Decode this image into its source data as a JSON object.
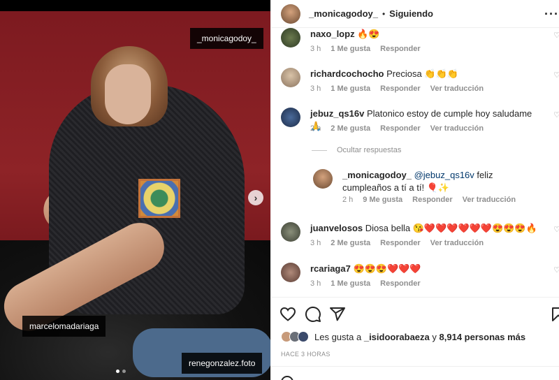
{
  "photo": {
    "tags": [
      "_monicagodoy_",
      "marcelomadariaga",
      "renegonzalez.foto"
    ]
  },
  "header": {
    "username": "_monicagodoy_",
    "separator": "•",
    "follow_status": "Siguiendo",
    "more": "···"
  },
  "comments": [
    {
      "user": "naxo_lopz",
      "text": "🔥😍",
      "time": "3 h",
      "likes": "1 Me gusta",
      "reply": "Responder",
      "translate": ""
    },
    {
      "user": "richardcochocho",
      "text": "Preciosa 👏👏👏",
      "time": "3 h",
      "likes": "1 Me gusta",
      "reply": "Responder",
      "translate": "Ver traducción"
    },
    {
      "user": "jebuz_qs16v",
      "text": "Platonico estoy de cumple hoy saludame 🙏",
      "time": "2 h",
      "likes": "2 Me gusta",
      "reply": "Responder",
      "translate": "Ver traducción"
    },
    {
      "user": "juanvelosos",
      "text": "Diosa bella 😘❤️❤️❤️❤️❤️❤️😍😍😍🔥",
      "time": "3 h",
      "likes": "2 Me gusta",
      "reply": "Responder",
      "translate": "Ver traducción"
    },
    {
      "user": "rcariaga7",
      "text": "😍😍😍❤️❤️❤️",
      "time": "3 h",
      "likes": "1 Me gusta",
      "reply": "Responder",
      "translate": ""
    }
  ],
  "hide_replies": "Ocultar respuestas",
  "reply": {
    "user": "_monicagodoy_",
    "mention": "@jebuz_qs16v",
    "text": "feliz cumpleaños a tí a tí! 🎈✨",
    "time": "2 h",
    "likes": "9 Me gusta",
    "reply": "Responder",
    "translate": "Ver traducción"
  },
  "likes": {
    "prefix": "Les gusta a",
    "user": "_isidoorabaeza",
    "connector": "y",
    "count": "8,914 personas más"
  },
  "time_ago": "HACE 3 HORAS",
  "icons": [
    "heart-icon",
    "comment-icon",
    "share-icon",
    "save-icon",
    "small-heart-icon",
    "next-arrow-icon",
    "emoji-icon"
  ]
}
